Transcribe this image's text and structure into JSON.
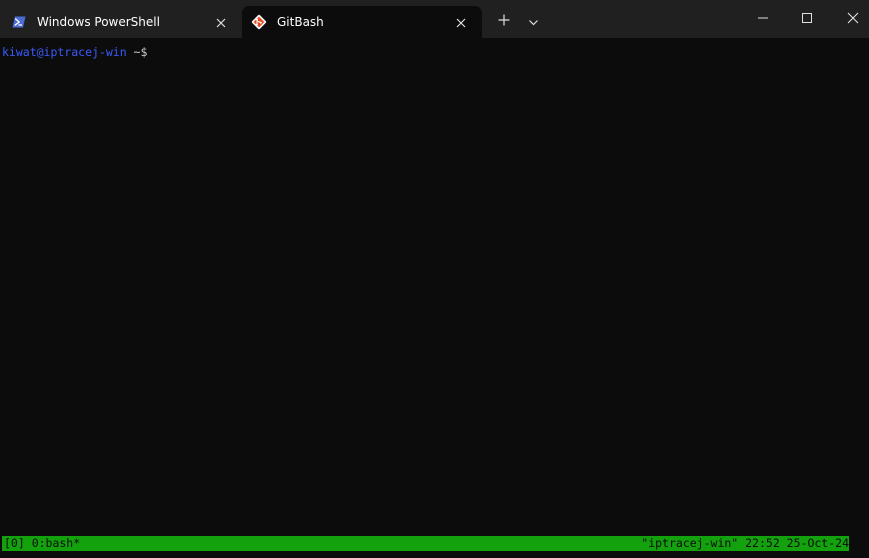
{
  "tabs": [
    {
      "label": "Windows PowerShell",
      "icon": "powershell-icon",
      "active": false
    },
    {
      "label": "GitBash",
      "icon": "git-icon",
      "active": true
    }
  ],
  "controls": {
    "new_tab_icon": "plus-icon",
    "dropdown_icon": "chevron-down-icon",
    "minimize_icon": "minimize-icon",
    "maximize_icon": "maximize-icon",
    "close_icon": "close-icon"
  },
  "terminal": {
    "prompt_user": "kiwat@iptracej-win",
    "prompt_path": " ~$"
  },
  "statusbar": {
    "left": "[0] 0:bash*",
    "right": "\"iptracej-win\" 22:52 25-Oct-24"
  },
  "colors": {
    "tabbar_bg": "#202020",
    "terminal_bg": "#0c0c0c",
    "prompt_user": "#3b5bff",
    "status_bg": "#13a10e"
  }
}
